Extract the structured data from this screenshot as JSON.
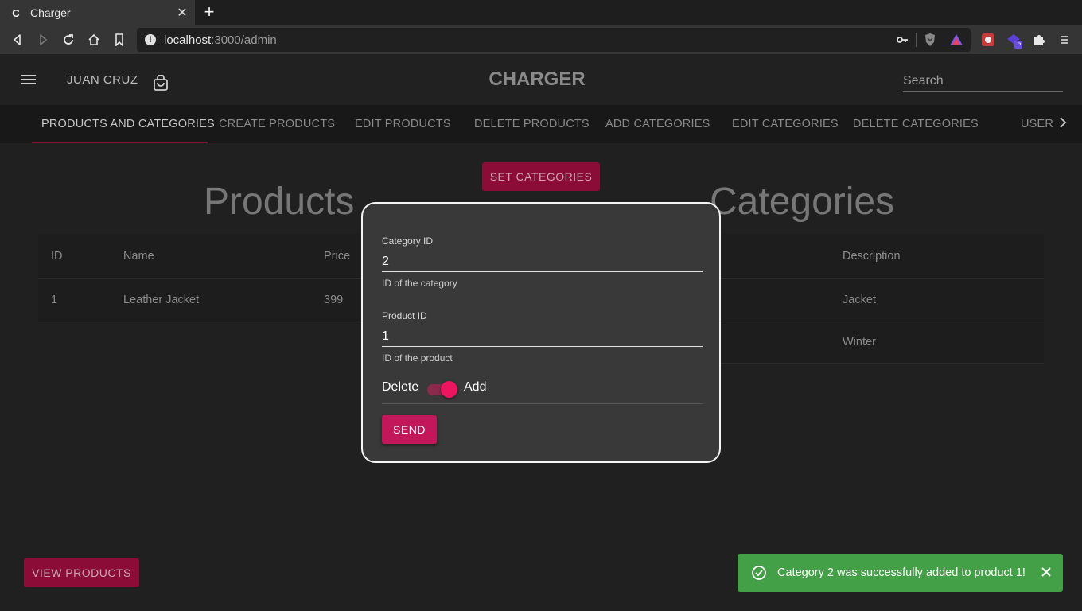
{
  "browser": {
    "tab_title": "Charger",
    "tab_favicon_letter": "C",
    "url_host": "localhost",
    "url_path": ":3000/admin",
    "extension_badge": "5"
  },
  "header": {
    "user_name": "JUAN CRUZ",
    "brand": "CHARGER",
    "search_placeholder": "Search"
  },
  "tabs": [
    {
      "label": "PRODUCTS AND CATEGORIES",
      "active": true
    },
    {
      "label": "CREATE PRODUCTS"
    },
    {
      "label": "EDIT PRODUCTS"
    },
    {
      "label": "DELETE PRODUCTS"
    },
    {
      "label": "ADD CATEGORIES"
    },
    {
      "label": "EDIT CATEGORIES"
    },
    {
      "label": "DELETE CATEGORIES"
    },
    {
      "label": "USER"
    }
  ],
  "main": {
    "set_categories_label": "SET CATEGORIES",
    "products_title": "Products",
    "categories_title": "Categories",
    "products_table": {
      "headers": [
        "ID",
        "Name",
        "Price"
      ],
      "rows": [
        [
          "1",
          "Leather Jacket",
          "399"
        ]
      ]
    },
    "categories_table": {
      "headers": [
        "Description"
      ],
      "rows": [
        [
          "Jacket"
        ],
        [
          "Winter"
        ]
      ]
    },
    "view_products_label": "VIEW PRODUCTS"
  },
  "modal": {
    "category_label": "Category ID",
    "category_value": "2",
    "category_help": "ID of the category",
    "product_label": "Product ID",
    "product_value": "1",
    "product_help": "ID of the product",
    "switch_off_label": "Delete",
    "switch_on_label": "Add",
    "switch_checked": true,
    "send_label": "SEND"
  },
  "toast": {
    "message": "Category 2 was successfully added to product 1!",
    "color": "#43a047"
  },
  "colors": {
    "accent": "#c2185b",
    "accent_dark": "#8c0c38"
  }
}
